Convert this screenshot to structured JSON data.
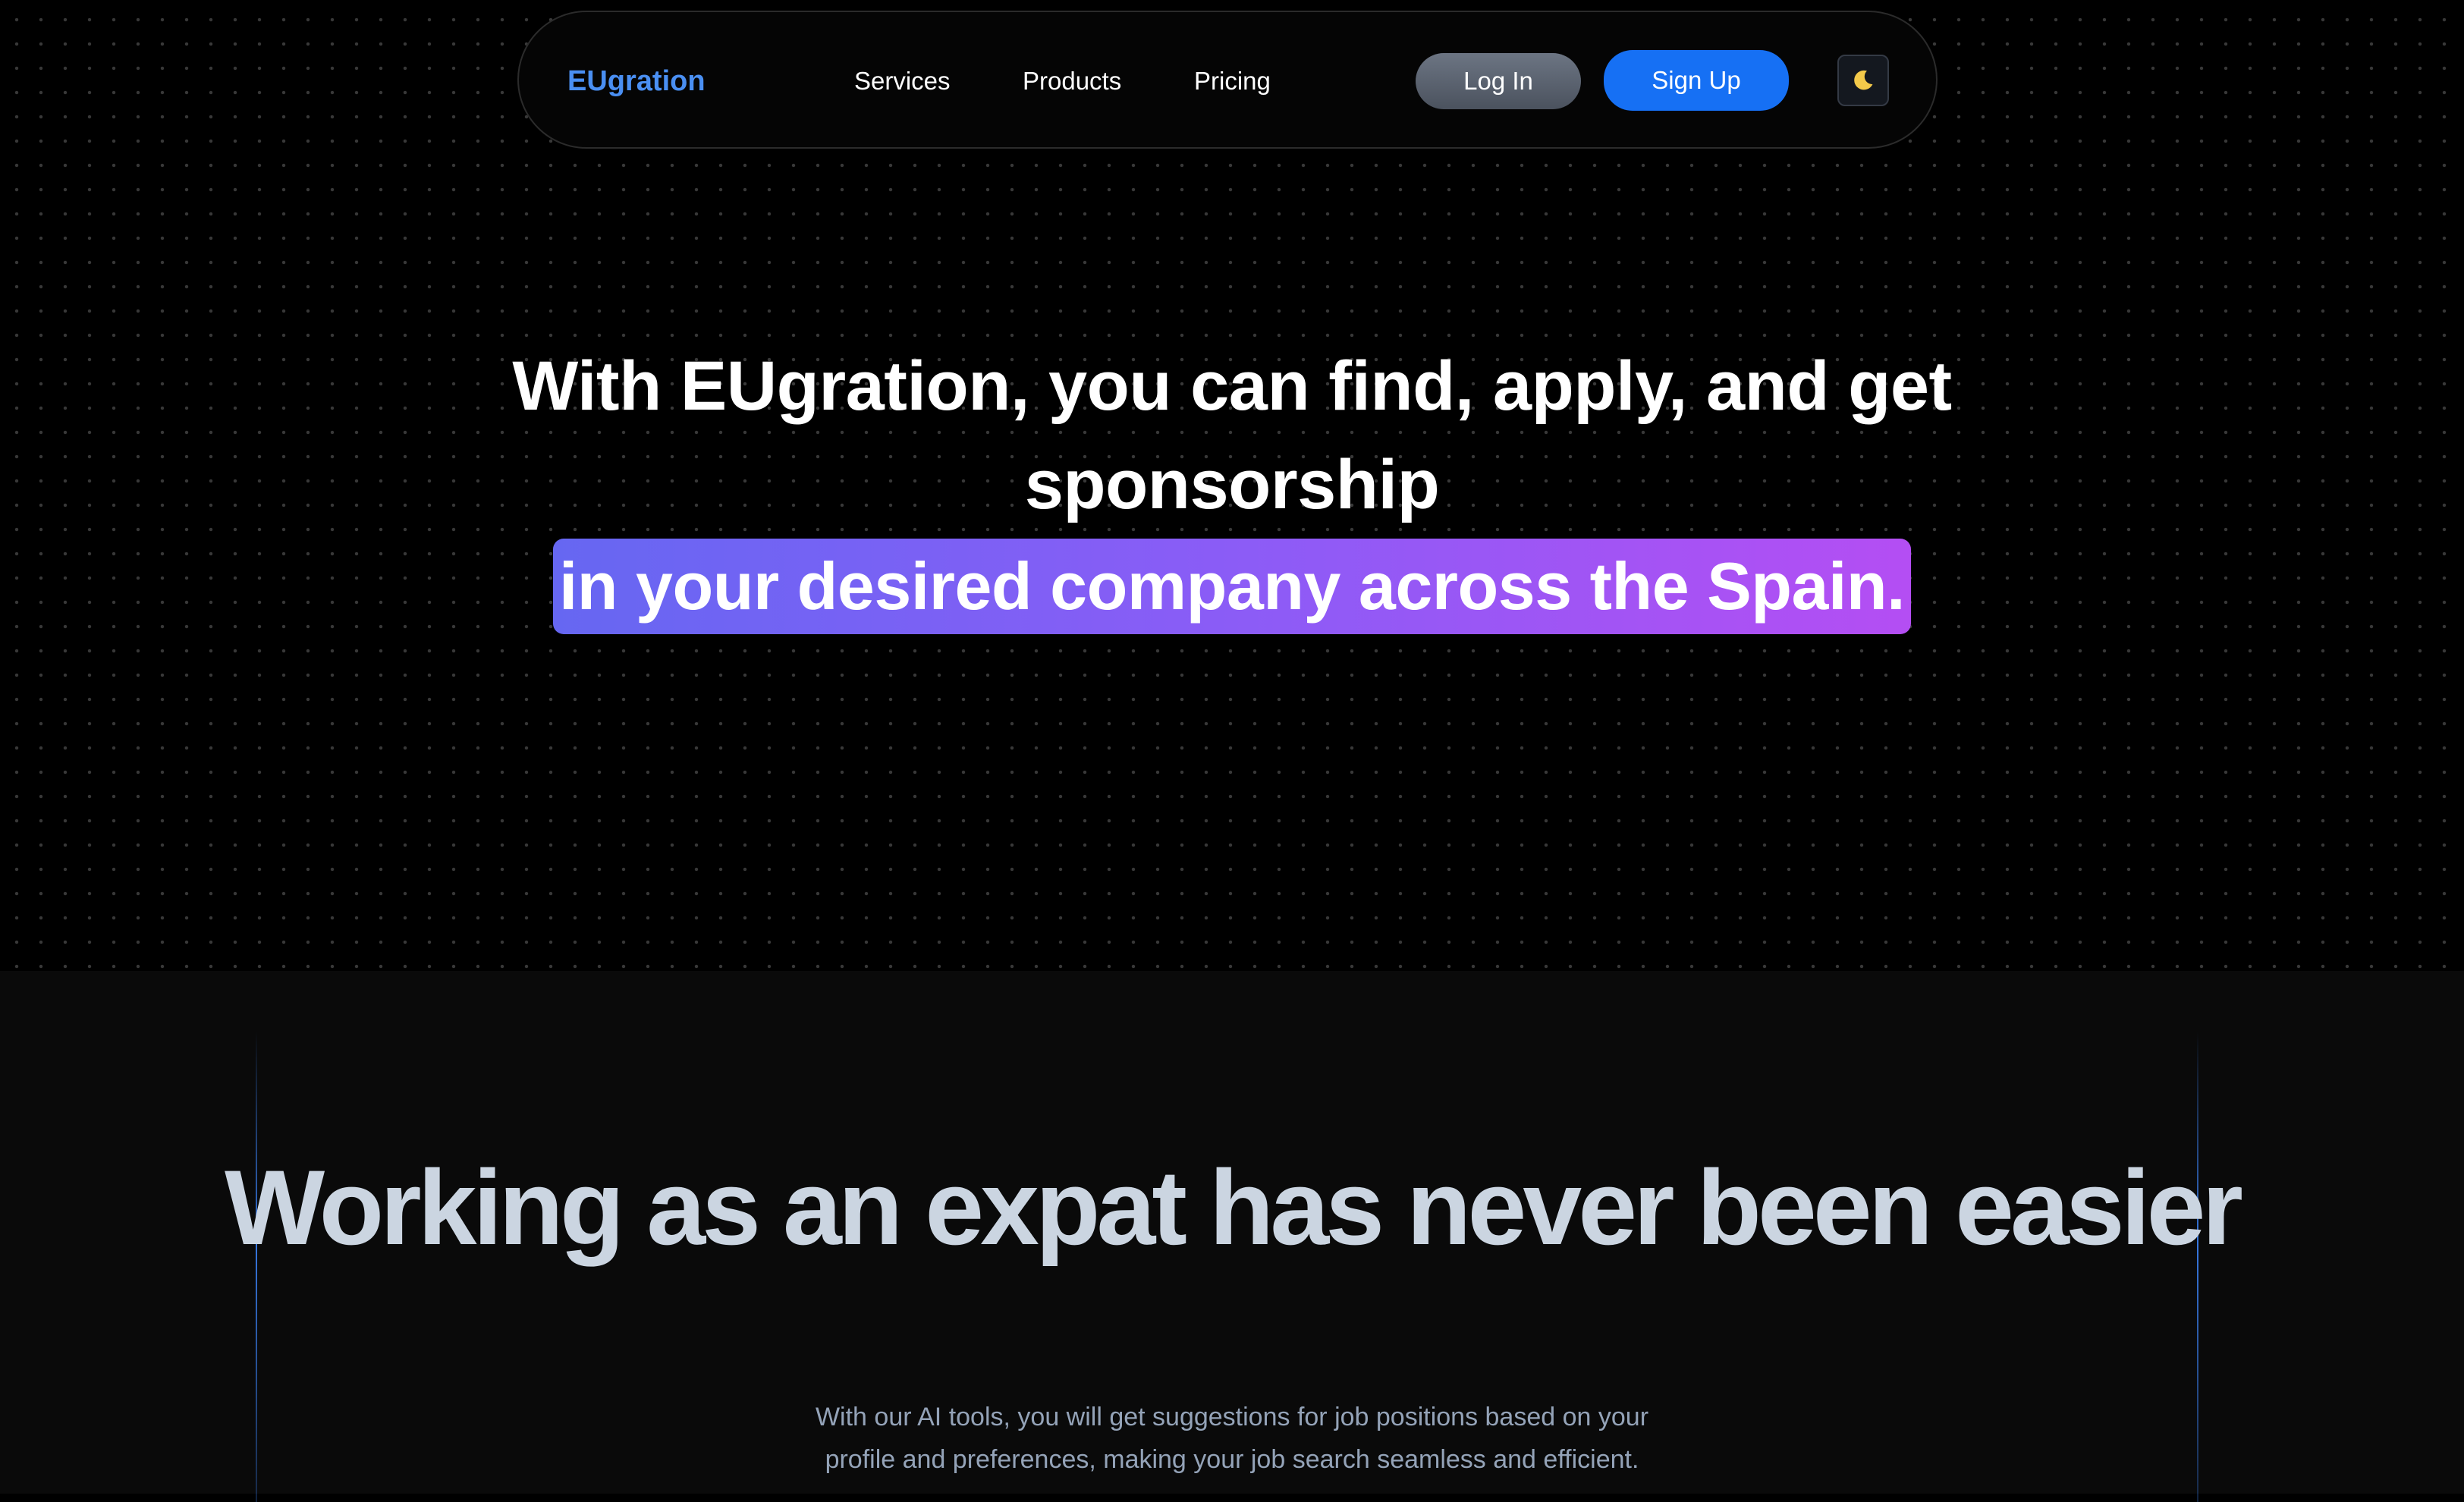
{
  "nav": {
    "logo": "EUgration",
    "links": [
      "Services",
      "Products",
      "Pricing"
    ],
    "login_label": "Log In",
    "signup_label": "Sign Up",
    "theme_icon": "moon-icon"
  },
  "hero": {
    "title": "With EUgration, you can find, apply, and get sponsorship",
    "highlight": "in your desired company across the Spain."
  },
  "section": {
    "title": "Working as an expat has never been easier",
    "description": "With our AI tools, you will get suggestions for job positions based on your profile and preferences, making your job search seamless and efficient."
  },
  "colors": {
    "brand": "#4a8ff2",
    "signup": "#1670f4",
    "highlight_start": "#6667f2",
    "highlight_end": "#b44ef3",
    "section_title": "#cbd5e1"
  }
}
